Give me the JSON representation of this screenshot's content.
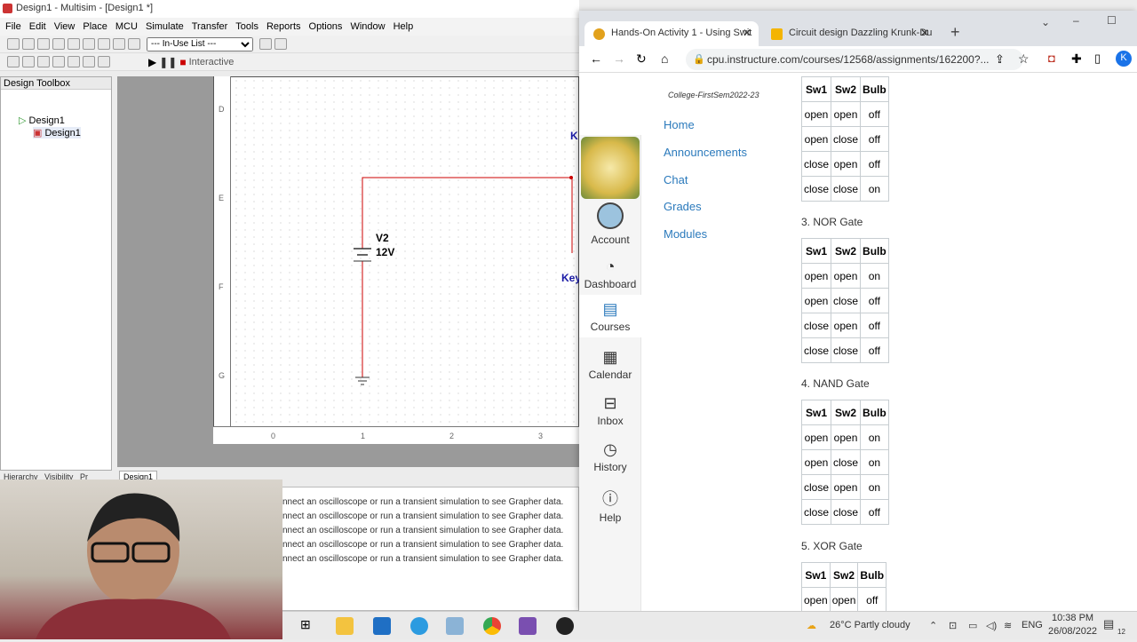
{
  "multisim": {
    "title": "Design1 - Multisim - [Design1 *]",
    "menu": [
      "File",
      "Edit",
      "View",
      "Place",
      "MCU",
      "Simulate",
      "Transfer",
      "Tools",
      "Reports",
      "Options",
      "Window",
      "Help"
    ],
    "inuse_list": "--- In-Use List ---",
    "interactive_label": "Interactive",
    "toolbox": {
      "title": "Design Toolbox",
      "root": "Design1",
      "child": "Design1",
      "tabs": [
        "Hierarchy",
        "Visibility",
        "Pr"
      ]
    },
    "doc_tab": "Design1",
    "rows": [
      "D",
      "E",
      "F",
      "G"
    ],
    "cols": [
      "0",
      "1",
      "2",
      "3"
    ],
    "component": {
      "name": "V2",
      "value": "12V"
    },
    "partial_labels": [
      "K",
      "Key"
    ],
    "grapher_lines": [
      "nnect an oscilloscope or run a transient simulation to see Grapher data.",
      "nnect an oscilloscope or run a transient simulation to see Grapher data.",
      "nnect an oscilloscope or run a transient simulation to see Grapher data.",
      "nnect an oscilloscope or run a transient simulation to see Grapher data.",
      "nnect an oscilloscope or run a transient simulation to see Grapher data."
    ]
  },
  "browser": {
    "tabs": [
      {
        "label": "Hands-On Activity 1 - Using Swit",
        "active": true
      },
      {
        "label": "Circuit design Dazzling Krunk-Du",
        "active": false
      }
    ],
    "url": "cpu.instructure.com/courses/12568/assignments/162200?...",
    "profile_letter": "K",
    "course_subtitle": "College-FirstSem2022-23",
    "global_nav": [
      "Account",
      "Dashboard",
      "Courses",
      "Calendar",
      "Inbox",
      "History",
      "Help"
    ],
    "course_nav": [
      "Home",
      "Announcements",
      "Chat",
      "Grades",
      "Modules"
    ],
    "table_header": [
      "Sw1",
      "Sw2",
      "Bulb"
    ],
    "tables": [
      {
        "title": "",
        "rows": [
          [
            "open",
            "open",
            "off"
          ],
          [
            "open",
            "close",
            "off"
          ],
          [
            "close",
            "open",
            "off"
          ],
          [
            "close",
            "close",
            "on"
          ]
        ]
      },
      {
        "title": "3. NOR Gate",
        "rows": [
          [
            "open",
            "open",
            "on"
          ],
          [
            "open",
            "close",
            "off"
          ],
          [
            "close",
            "open",
            "off"
          ],
          [
            "close",
            "close",
            "off"
          ]
        ]
      },
      {
        "title": "4. NAND Gate",
        "rows": [
          [
            "open",
            "open",
            "on"
          ],
          [
            "open",
            "close",
            "on"
          ],
          [
            "close",
            "open",
            "on"
          ],
          [
            "close",
            "close",
            "off"
          ]
        ]
      },
      {
        "title": "5. XOR Gate",
        "rows": [
          [
            "open",
            "open",
            "off"
          ]
        ]
      }
    ]
  },
  "taskbar": {
    "weather": "26°C Partly cloudy",
    "lang": "ENG",
    "time": "10:38 PM",
    "date": "26/08/2022",
    "notif": "12"
  }
}
